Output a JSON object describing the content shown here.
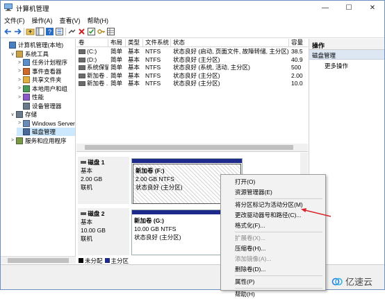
{
  "window": {
    "title": "计算机管理",
    "min": "—",
    "max": "☐",
    "close": "✕"
  },
  "menu": [
    "文件(F)",
    "操作(A)",
    "查看(V)",
    "帮助(H)"
  ],
  "tree": [
    {
      "label": "计算机管理(本地)",
      "exp": "",
      "indent": 0,
      "icon": "computer-icon"
    },
    {
      "label": "系统工具",
      "exp": "∨",
      "indent": 1,
      "icon": "tools-icon"
    },
    {
      "label": "任务计划程序",
      "exp": ">",
      "indent": 2,
      "icon": "clock-icon"
    },
    {
      "label": "事件查看器",
      "exp": ">",
      "indent": 2,
      "icon": "event-icon"
    },
    {
      "label": "共享文件夹",
      "exp": ">",
      "indent": 2,
      "icon": "folder-icon"
    },
    {
      "label": "本地用户和组",
      "exp": ">",
      "indent": 2,
      "icon": "users-icon"
    },
    {
      "label": "性能",
      "exp": ">",
      "indent": 2,
      "icon": "performance-icon"
    },
    {
      "label": "设备管理器",
      "exp": "",
      "indent": 2,
      "icon": "device-icon"
    },
    {
      "label": "存储",
      "exp": "∨",
      "indent": 1,
      "icon": "storage-icon"
    },
    {
      "label": "Windows Server",
      "exp": ">",
      "indent": 2,
      "icon": "server-icon"
    },
    {
      "label": "磁盘管理",
      "exp": "",
      "indent": 2,
      "icon": "disk-icon",
      "selected": true
    },
    {
      "label": "服务和应用程序",
      "exp": ">",
      "indent": 1,
      "icon": "services-icon"
    }
  ],
  "volume_list": {
    "headers": [
      "卷",
      "布局",
      "类型",
      "文件系统",
      "状态",
      "容量"
    ],
    "rows": [
      [
        "(C:)",
        "简单",
        "基本",
        "NTFS",
        "状态良好 (启动, 页面文件, 故障转储, 主分区)",
        "38.5"
      ],
      [
        "(D:)",
        "简单",
        "基本",
        "NTFS",
        "状态良好 (主分区)",
        "40.9"
      ],
      [
        "系统保留",
        "简单",
        "基本",
        "NTFS",
        "状态良好 (系统, 活动, 主分区)",
        "500"
      ],
      [
        "新加卷 ...",
        "简单",
        "基本",
        "NTFS",
        "状态良好 (主分区)",
        "2.00"
      ],
      [
        "新加卷 ...",
        "简单",
        "基本",
        "NTFS",
        "状态良好 (主分区)",
        "10.0"
      ]
    ]
  },
  "disks": [
    {
      "name": "磁盘 1",
      "type": "基本",
      "size": "2.00 GB",
      "status": "联机",
      "partition": {
        "name": "新加卷  (F:)",
        "fs": "2.00 GB NTFS",
        "status": "状态良好 (主分区)"
      }
    },
    {
      "name": "磁盘 2",
      "type": "基本",
      "size": "10.00 GB",
      "status": "联机",
      "partition": {
        "name": "新加卷  (G:)",
        "fs": "10.00 GB NTFS",
        "status": "状态良好 (主分区)"
      }
    }
  ],
  "legend": [
    {
      "label": "未分配",
      "color": "#000000"
    },
    {
      "label": "主分区",
      "color": "#1d2a8c"
    }
  ],
  "actions": {
    "header": "操作",
    "item": "磁盘管理",
    "more": "更多操作"
  },
  "context_menu": [
    {
      "label": "打开(O)",
      "disabled": false
    },
    {
      "label": "资源管理器(E)",
      "disabled": false
    },
    {
      "sep": true
    },
    {
      "label": "将分区标记为活动分区(M)",
      "disabled": false
    },
    {
      "label": "更改驱动器号和路径(C)...",
      "disabled": false
    },
    {
      "label": "格式化(F)...",
      "disabled": false
    },
    {
      "sep": true
    },
    {
      "label": "扩展卷(X)...",
      "disabled": true
    },
    {
      "label": "压缩卷(H)...",
      "disabled": false
    },
    {
      "label": "添加镜像(A)...",
      "disabled": true
    },
    {
      "label": "删除卷(D)...",
      "disabled": false
    },
    {
      "sep": true
    },
    {
      "label": "属性(P)",
      "disabled": false
    },
    {
      "sep": true
    },
    {
      "label": "帮助(H)",
      "disabled": false
    }
  ],
  "annotation": {
    "color": "#d9262b"
  },
  "watermark": "亿速云"
}
